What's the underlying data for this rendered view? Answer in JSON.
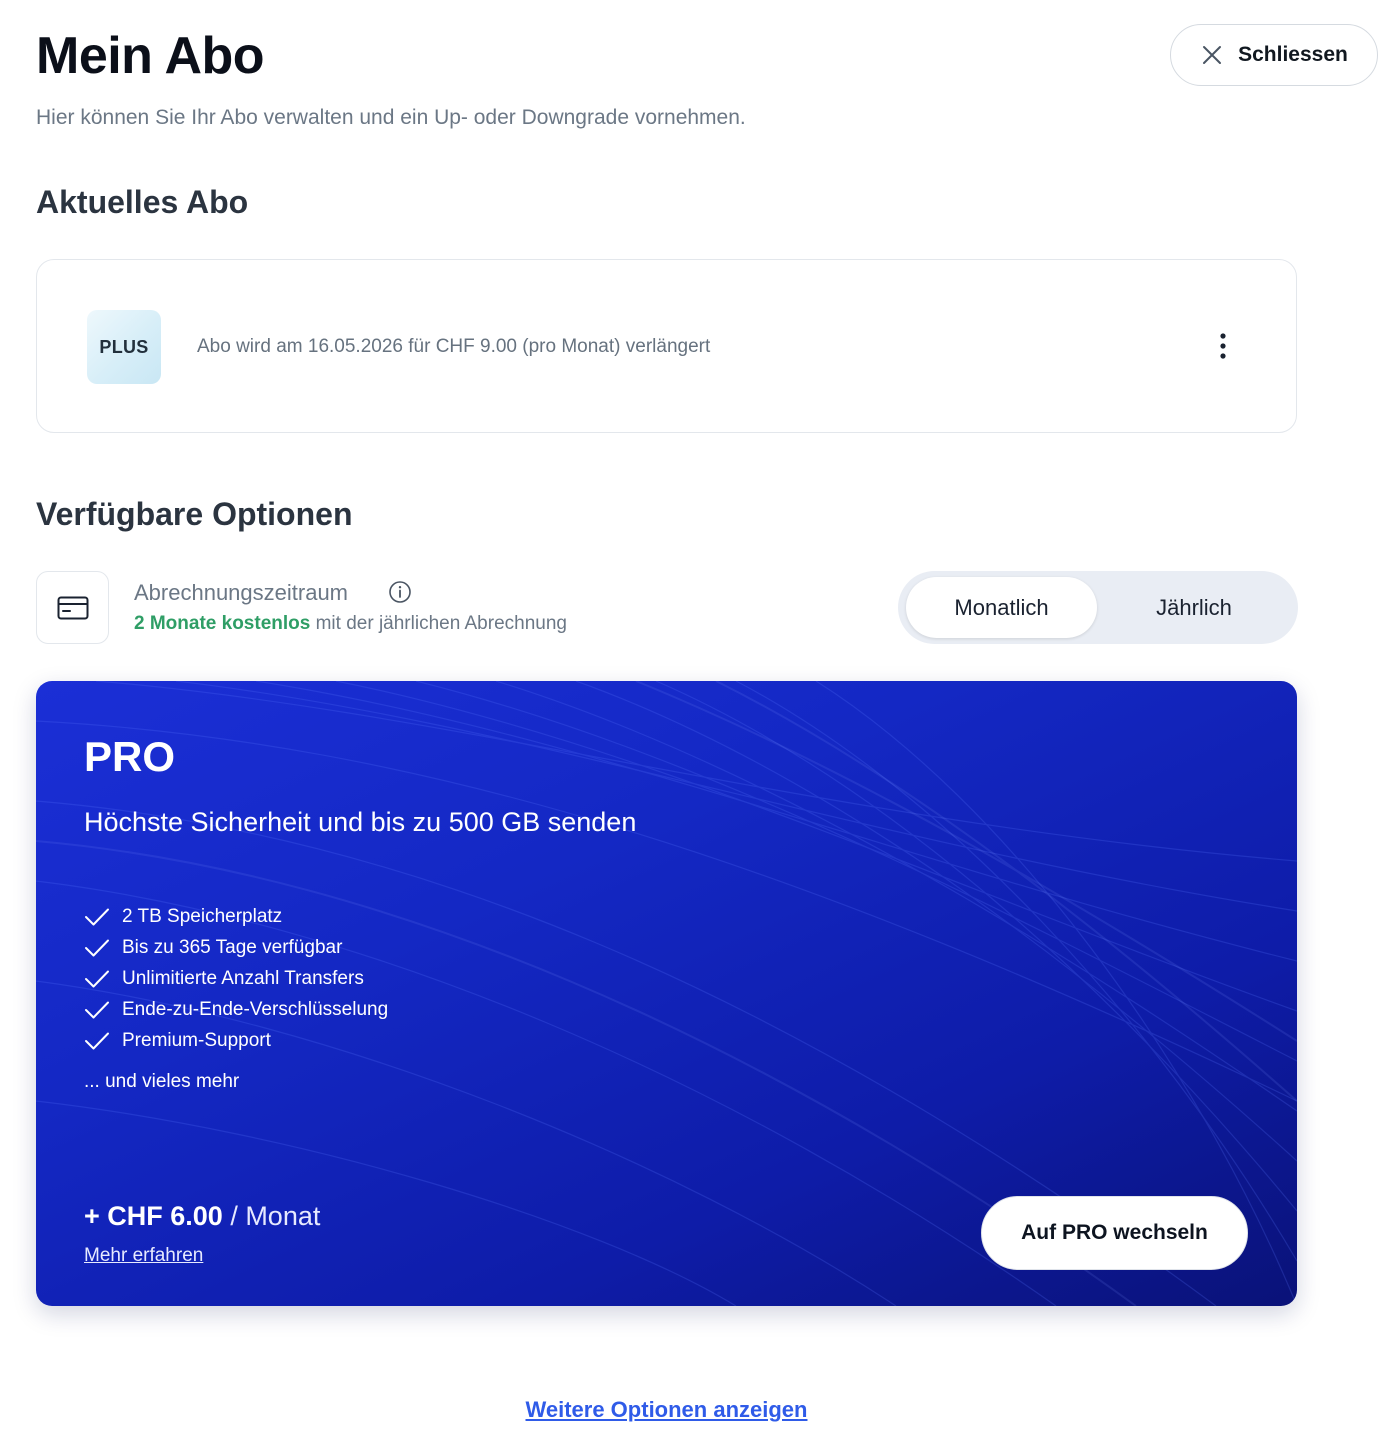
{
  "header": {
    "title": "Mein Abo",
    "subtitle": "Hier können Sie Ihr Abo verwalten und ein Up- oder Downgrade vornehmen.",
    "close_label": "Schliessen",
    "close_icon": "close-icon"
  },
  "current": {
    "section_title": "Aktuelles Abo",
    "plan_badge": "PLUS",
    "renewal_text": "Abo wird am 16.05.2026 für CHF 9.00 (pro Monat) verlängert",
    "menu_icon": "more-vertical-icon"
  },
  "options": {
    "section_title": "Verfügbare Optionen",
    "billing": {
      "icon": "credit-card-icon",
      "label": "Abrechnungszeitraum",
      "info_icon": "info-icon",
      "hint_highlight": "2 Monate kostenlos",
      "hint_rest": " mit der jährlichen Abrechnung",
      "periods": [
        "Monatlich",
        "Jährlich"
      ],
      "selected": "Monatlich"
    }
  },
  "pro": {
    "title": "PRO",
    "tagline": "Höchste Sicherheit und bis zu 500 GB senden",
    "features": [
      "2 TB Speicherplatz",
      "Bis zu 365 Tage verfügbar",
      "Unlimitierte Anzahl Transfers",
      "Ende-zu-Ende-Verschlüsselung",
      "Premium-Support"
    ],
    "more_features": "... und vieles mehr",
    "price": "+ CHF 6.00",
    "price_unit": " / Monat",
    "learn_more": "Mehr erfahren",
    "cta": "Auf PRO wechseln"
  },
  "footer": {
    "more_options": "Weitere Optionen anzeigen"
  },
  "colors": {
    "accent_link": "#2f5be8",
    "free_highlight": "#2f9e66",
    "pro_card_bg": "#1428c4"
  }
}
